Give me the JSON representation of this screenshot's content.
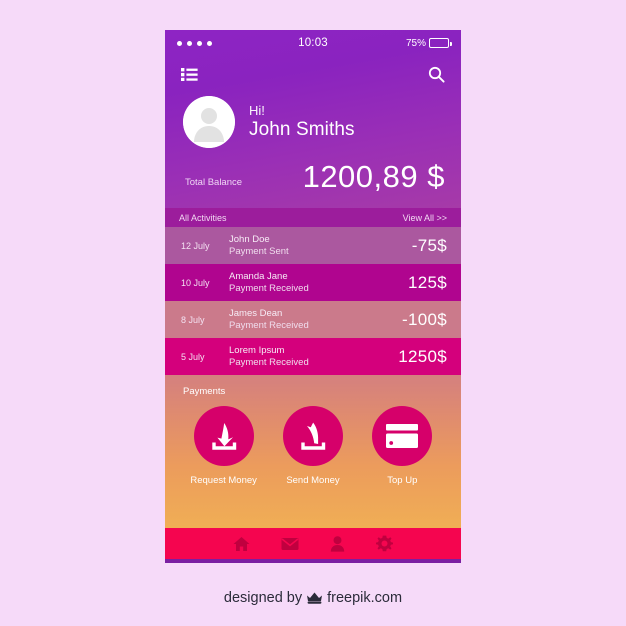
{
  "background_color": "#f6daf9",
  "statusbar": {
    "signal_dots": 4,
    "time": "10:03",
    "battery_percent": "75%",
    "battery_level": 75
  },
  "appbar": {
    "menu_icon": "list-menu-icon",
    "search_icon": "search-icon"
  },
  "profile": {
    "avatar_icon": "user-avatar-icon",
    "greeting": "Hi!",
    "name": "John Smiths"
  },
  "balance": {
    "label": "Total Balance",
    "amount": "1200,89 $"
  },
  "activities": {
    "title": "All Activities",
    "view_all": "View All >>",
    "rows": [
      {
        "date": "12 July",
        "name": "John Doe",
        "subtitle": "Payment Sent",
        "amount": "-75$",
        "color": "#ab589f"
      },
      {
        "date": "10 July",
        "name": "Amanda Jane",
        "subtitle": "Payment Received",
        "amount": "125$",
        "color": "#b0058f"
      },
      {
        "date": "8 July",
        "name": "James Dean",
        "subtitle": "Payment Received",
        "amount": "-100$",
        "color": "#cb7a8b"
      },
      {
        "date": "5 July",
        "name": "Lorem Ipsum",
        "subtitle": "Payment Received",
        "amount": "1250$",
        "color": "#d4007c"
      }
    ]
  },
  "payments": {
    "title": "Payments",
    "circle_color": "#d6006a",
    "items": [
      {
        "label": "Request Money",
        "icon": "download-arrow-icon"
      },
      {
        "label": "Send Money",
        "icon": "upload-arrow-icon"
      },
      {
        "label": "Top Up",
        "icon": "credit-card-icon"
      }
    ]
  },
  "bottom_nav": {
    "bar_color": "#f5054f",
    "icon_color": "#c0003f",
    "items": [
      {
        "icon": "home-icon"
      },
      {
        "icon": "envelope-icon"
      },
      {
        "icon": "person-icon"
      },
      {
        "icon": "gear-icon"
      }
    ]
  },
  "footer": {
    "prefix": "designed by",
    "brand": "freepik.com",
    "logo_icon": "freepik-crown-icon"
  }
}
